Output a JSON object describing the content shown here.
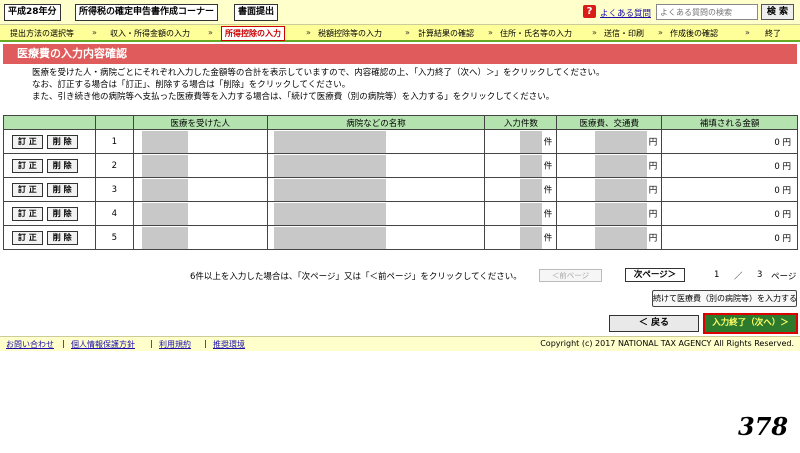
{
  "header": {
    "year_tag": "平成28年分",
    "corner_tag": "所得税の確定申告書作成コーナー",
    "submit_tag": "書面提出",
    "help_label": "?",
    "faq_label": "よくある質問",
    "search_placeholder": "よくある質問の検索",
    "search_button": "検 索"
  },
  "steps": [
    "提出方法の選択等",
    "収入・所得金額の入力",
    "所得控除の入力",
    "税額控除等の入力",
    "計算結果の確認",
    "住所・氏名等の入力",
    "送信・印刷",
    "作成後の確認",
    "終了"
  ],
  "step_arrow": "»",
  "active_step_index": 2,
  "section_title": "医療費の入力内容確認",
  "instructions": [
    "医療を受けた人・病院ごとにそれぞれ入力した金額等の合計を表示していますので、内容確認の上、「入力終了（次へ）＞」をクリックしてください。",
    "なお、訂正する場合は「訂正」、削除する場合は「削除」をクリックしてください。",
    "また、引き続き他の病院等へ支払った医療費等を入力する場合は、「続けて医療費（別の病院等）を入力する」をクリックしてください。"
  ],
  "table": {
    "headers": [
      "医療を受けた人",
      "病院などの名称",
      "入力件数",
      "医療費、交通費",
      "補填される金額"
    ],
    "edit_label": "訂 正",
    "delete_label": "削 除",
    "count_suffix": "件",
    "yen_suffix": "円",
    "rows": [
      {
        "no": "1",
        "compensation": "0 円"
      },
      {
        "no": "2",
        "compensation": "0 円"
      },
      {
        "no": "3",
        "compensation": "0 円"
      },
      {
        "no": "4",
        "compensation": "0 円"
      },
      {
        "no": "5",
        "compensation": "0 円"
      }
    ]
  },
  "pager": {
    "note": "6件以上を入力した場合は、「次ページ」又は「＜前ページ」をクリックしてください。",
    "prev_label": "＜前ページ",
    "next_label": "次ページ＞",
    "current": "1",
    "separator": "／",
    "total": "3",
    "unit": "ページ"
  },
  "buttons": {
    "continue": "続けて医療費（別の病院等）を入力する",
    "back": "＜ 戻る",
    "finish": "入力終了（次へ）＞"
  },
  "footer": {
    "links": [
      "お問い合わせ",
      "個人情報保護方針",
      "利用規約",
      "推奨環境"
    ],
    "separator": "|",
    "copyright": "Copyright (c) 2017 NATIONAL TAX AGENCY All Rights Reserved."
  },
  "stamp": "378"
}
